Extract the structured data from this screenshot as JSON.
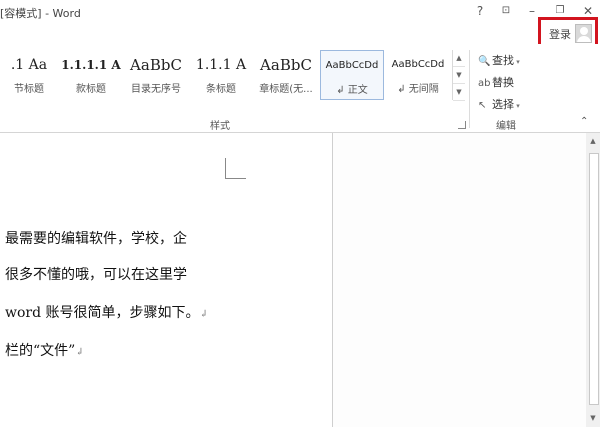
{
  "window": {
    "title": "[容模式] - Word",
    "help": "?",
    "ribbon_display": "⊡",
    "minimize": "–",
    "restore": "❐",
    "close": "✕"
  },
  "account": {
    "signin_label": "登录",
    "highlight_color": "#d2141f"
  },
  "styles_group": {
    "label": "样式",
    "items": [
      {
        "preview": ".1  Aa",
        "name": "节标题",
        "selected": false
      },
      {
        "preview": "1.1.1.1 A",
        "name": "款标题",
        "selected": false
      },
      {
        "preview": "AaBbC",
        "name": "目录无序号",
        "selected": false
      },
      {
        "preview": "1.1.1  A",
        "name": "条标题",
        "selected": false
      },
      {
        "preview": "AaBbC",
        "name": "章标题(无...",
        "selected": false
      },
      {
        "preview": "AaBbCcDd",
        "name": "↲ 正文",
        "selected": true
      },
      {
        "preview": "AaBbCcDd",
        "name": "↲ 无间隔",
        "selected": false
      }
    ]
  },
  "editing_group": {
    "label": "编辑",
    "find": "查找",
    "replace": "替换",
    "select": "选择"
  },
  "document": {
    "lines": [
      "最需要的编辑软件，学校，企",
      "很多不懂的哦，可以在这里学",
      "word 账号很简单，步骤如下。",
      "栏的“文件”"
    ],
    "paragraph_mark": "↲"
  }
}
